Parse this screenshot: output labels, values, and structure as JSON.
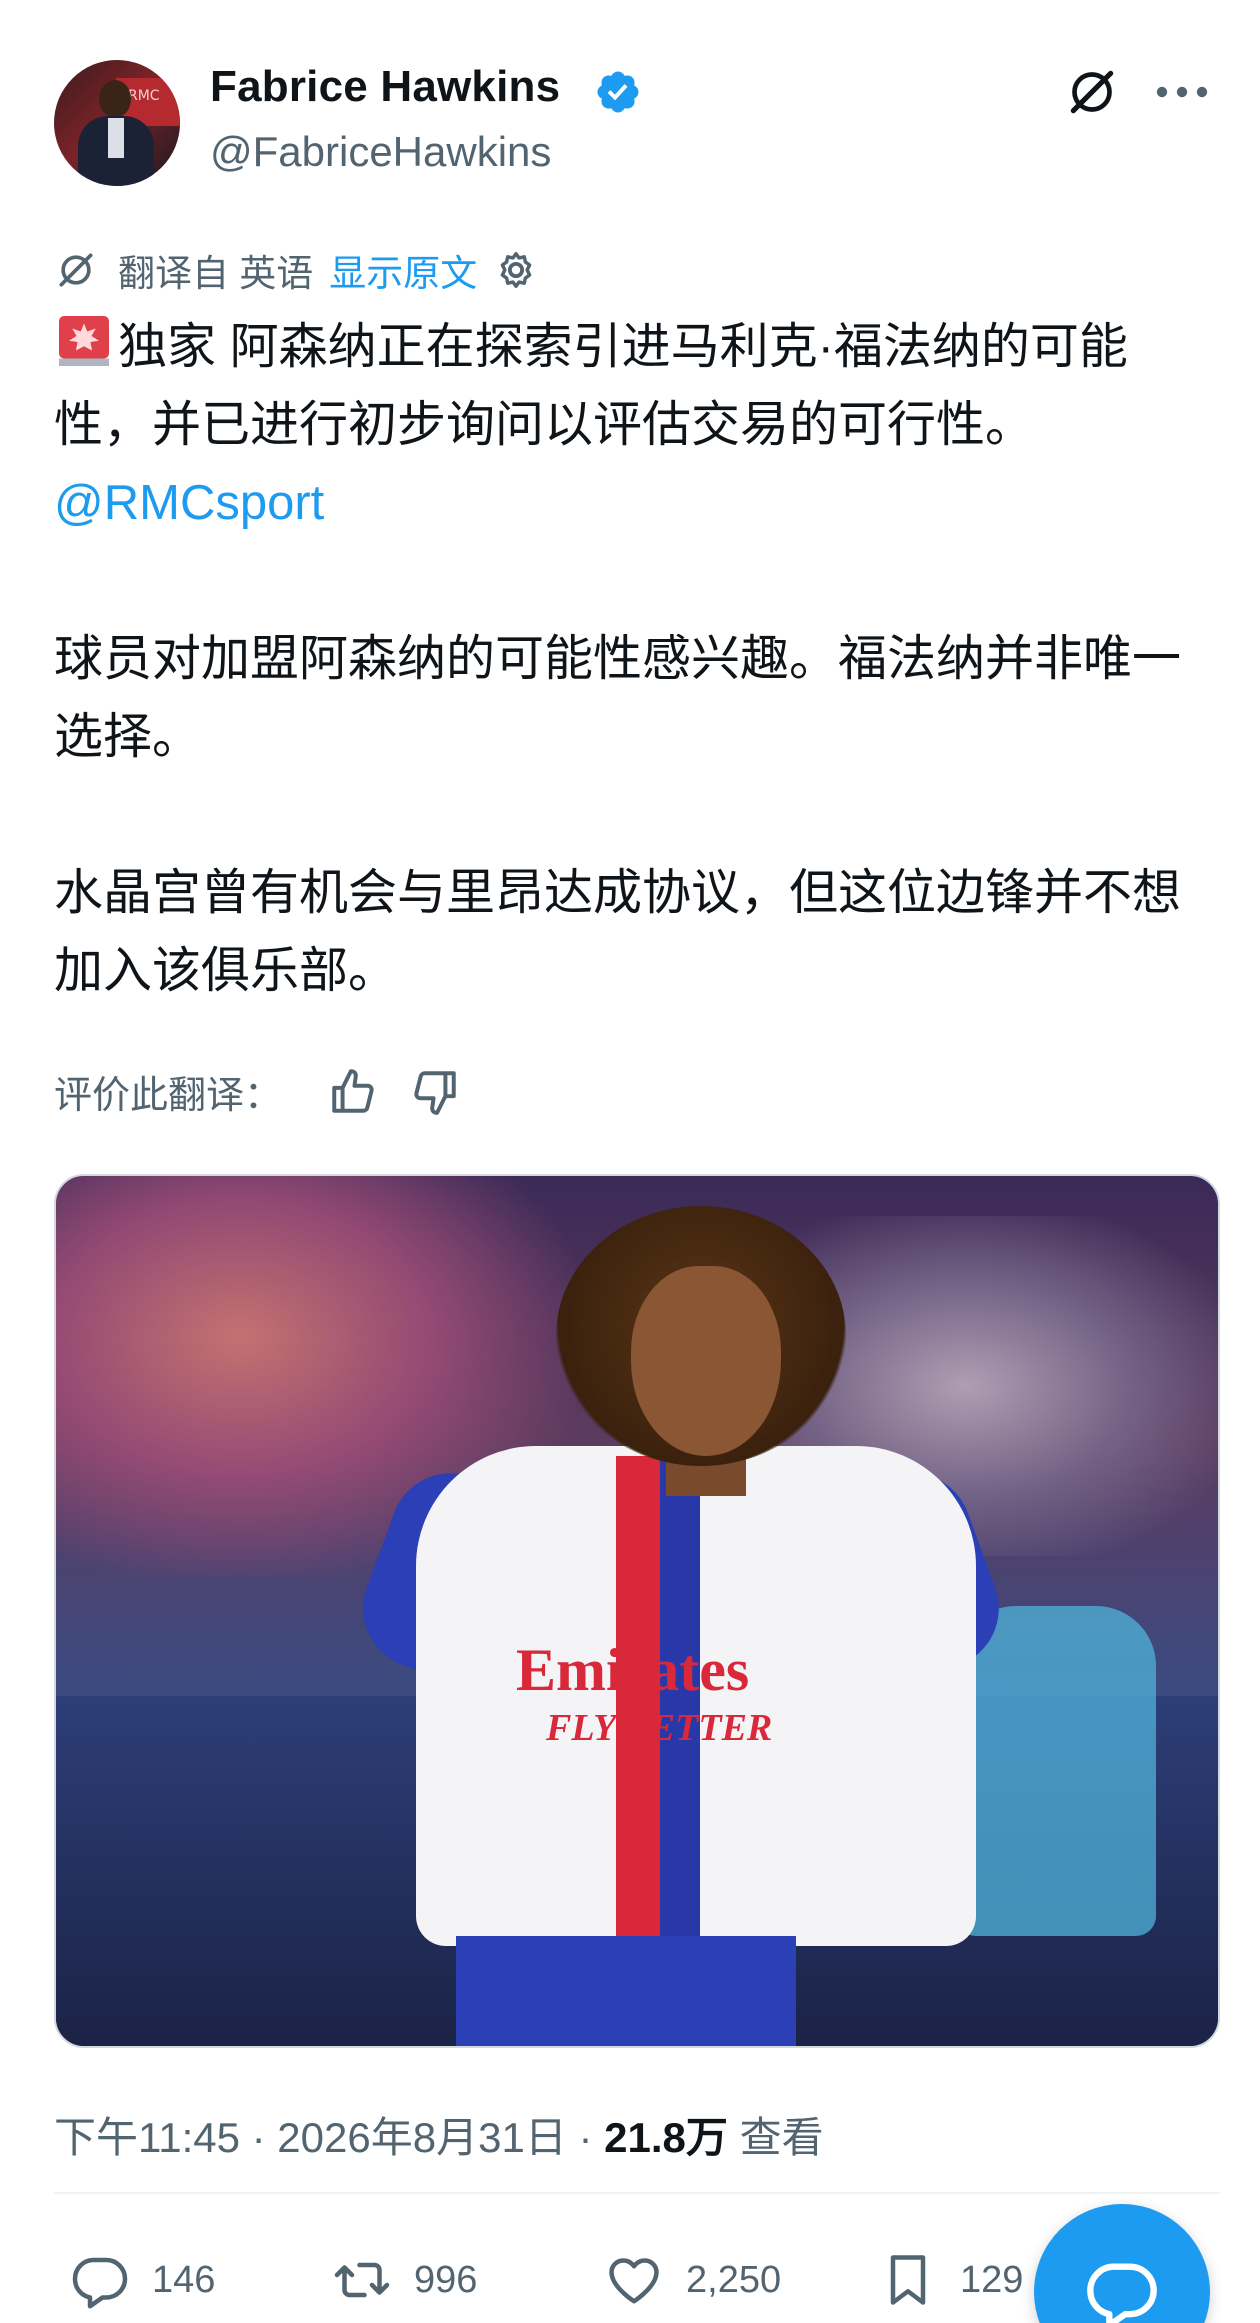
{
  "author": {
    "name": "Fabrice Hawkins",
    "handle": "@FabriceHawkins",
    "avatar_screen_text": "RMC",
    "verified_color": "#1d9bf0"
  },
  "translation": {
    "from_label": "翻译自 英语",
    "show_original": "显示原文"
  },
  "tweet": {
    "line1_after_siren": "独家 阿森纳正在探索引进马利克·福法纳的可能性，并已进行初步询问以评估交易的可行性。",
    "mention": "@RMCsport",
    "para2": "球员对加盟阿森纳的可能性感兴趣。福法纳并非唯一选择。",
    "para3": "水晶宫曾有机会与里昂达成协议，但这位边锋并不想加入该俱乐部。"
  },
  "rate": {
    "label": "评价此翻译："
  },
  "media": {
    "sponsor_line1": "Emirates",
    "sponsor_line2": "FLY BETTER"
  },
  "meta": {
    "time": "下午11:45 · 2026年8月31日 · ",
    "views_count": "21.8万",
    "views_label": " 查看"
  },
  "actions": {
    "replies": "146",
    "reposts": "996",
    "likes": "2,250",
    "bookmarks": "129"
  },
  "colors": {
    "accent": "#1d9bf0",
    "secondary_text": "#536471",
    "primary_text": "#0f1419"
  },
  "icons": [
    "grok-icon",
    "more-icon",
    "translate-icon",
    "gear-icon",
    "siren-icon",
    "thumbs-up-icon",
    "thumbs-down-icon",
    "reply-icon",
    "repost-icon",
    "like-icon",
    "bookmark-icon",
    "compose-icon"
  ]
}
